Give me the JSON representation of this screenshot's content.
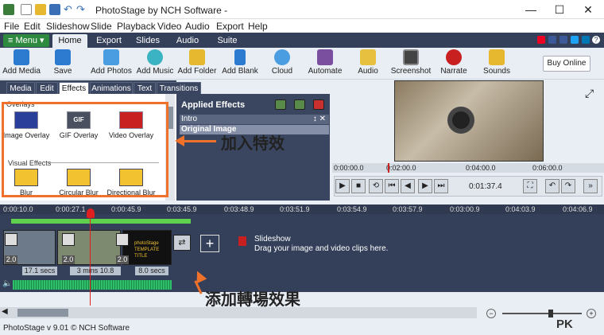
{
  "window": {
    "title": "PhotoStage by NCH Software -",
    "minimize": "—",
    "maximize": "☐",
    "close": "✕"
  },
  "menu": [
    "File",
    "Edit",
    "Slideshow",
    "Slide",
    "Playback",
    "Video",
    "Audio",
    "Export",
    "Help"
  ],
  "ribbon_tabs": {
    "menu_button": "≡ Menu ▾",
    "tabs": [
      "Home",
      "Export",
      "Slides",
      "Audio",
      "Suite"
    ],
    "active": "Home"
  },
  "toolbar": [
    "Add Media",
    "Save",
    "Add Photos",
    "Add Music",
    "Add Folder",
    "Add Blank",
    "Cloud",
    "Automate",
    "Audio",
    "Screenshot",
    "Narrate",
    "Sounds"
  ],
  "buy_now": "Buy Online",
  "help_icon": "?",
  "sub_tabs": {
    "tabs": [
      "Media",
      "Edit",
      "Effects",
      "Animations",
      "Text",
      "Transitions"
    ],
    "active": "Effects"
  },
  "effects_panel": {
    "overlays_label": "Overlays",
    "overlays": [
      "Image Overlay",
      "GIF Overlay",
      "Video Overlay"
    ],
    "gif_badge": "GIF",
    "visual_label": "Visual Effects",
    "visual": [
      "Blur",
      "Circular Blur",
      "Directional Blur"
    ]
  },
  "applied_effects": {
    "title": "Applied Effects",
    "items": [
      "Intro",
      "Original Image"
    ],
    "intro_controls": "↕  ✕"
  },
  "preview": {
    "times_top": [
      "0:00:00.0",
      "0:02:00.0",
      "0:04:00.0",
      "0:06:00.0"
    ],
    "current_time": "0:01:37.4",
    "fullscreen_icon": "⤢"
  },
  "callouts": {
    "add_effect": "加入特效",
    "add_transition": "添加轉場效果"
  },
  "timeline": {
    "ruler": [
      "0:00:10.0",
      "0:00:27.1",
      "0:00:45.9",
      "0:03:45.9",
      "0:03:48.9",
      "0:03:51.9",
      "0:03:54.9",
      "0:03:57.9",
      "0:03:00.9",
      "0:04:03.9",
      "0:04:06.9"
    ],
    "clips": [
      {
        "num": "2.0",
        "dur": "17.1 secs"
      },
      {
        "num": "2.0",
        "dur": "3 mins 10.8 secs"
      },
      {
        "num": "2.0",
        "dur": "8.0 secs"
      }
    ],
    "clip3_text": "photoStage TEMPLATE TITLE",
    "add_button": "+",
    "slideshow_title": "Slideshow",
    "slideshow_hint": "Drag your image and video clips here."
  },
  "status_bar": "PhotoStage v 9.01 © NCH Software",
  "watermark": "PK"
}
